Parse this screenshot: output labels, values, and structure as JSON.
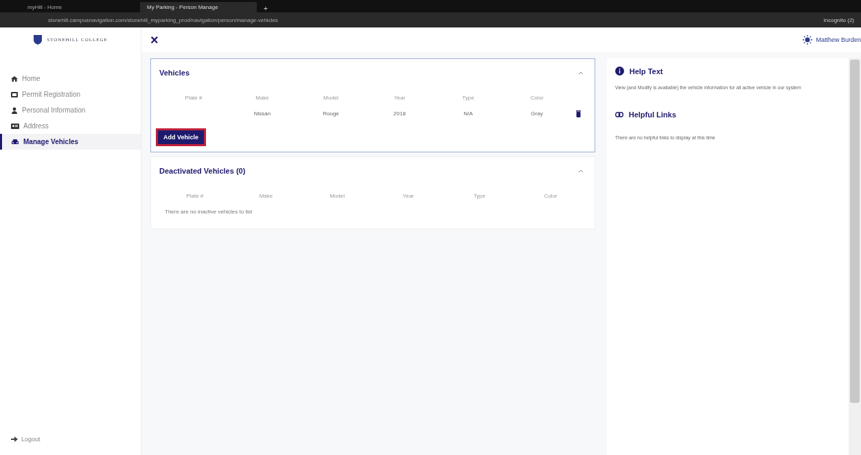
{
  "browser": {
    "tabs": [
      {
        "title": "myHill - Home",
        "selected": false
      },
      {
        "title": "My Parking - Person Manage",
        "selected": true
      }
    ],
    "new_tab": "+",
    "url": "stonehill.campusnavigation.com/stonehill_myparking_prod/navigation/person/manage-vehicles",
    "profile": "Incognito (2)"
  },
  "logo": "STONEHILL COLLEGE",
  "close": "×",
  "user": "Matthew Burden",
  "sidebar": {
    "items": [
      {
        "label": "Home",
        "kind": "home",
        "selected": false
      },
      {
        "label": "Permit Registration",
        "kind": "permit",
        "selected": false
      },
      {
        "label": "Personal Information",
        "kind": "person",
        "selected": false
      },
      {
        "label": "Address",
        "kind": "address",
        "selected": false
      },
      {
        "label": "Manage Vehicles",
        "kind": "car",
        "selected": true
      }
    ],
    "logout": "Logout"
  },
  "vehicles": {
    "title": "Vehicles",
    "columns": [
      "Plate #",
      "Make",
      "Model",
      "Year",
      "Type",
      "Color"
    ],
    "rows": [
      [
        "",
        "Nissan",
        "Rouge",
        "2018",
        "N/A",
        "Gray"
      ]
    ],
    "add_button": "Add Vehicle"
  },
  "deactivated": {
    "title": "Deactivated Vehicles (0)",
    "columns": [
      "Plate #",
      "Make",
      "Model",
      "Year",
      "Type",
      "Color"
    ],
    "empty": "There are no inactive vehicles to list"
  },
  "help": {
    "title": "Help Text",
    "text": "View (and Modify is available) the vehicle information for all active vehicle in our system"
  },
  "links": {
    "title": "Helpful Links",
    "text": "There are no helpful links to display at this time"
  }
}
